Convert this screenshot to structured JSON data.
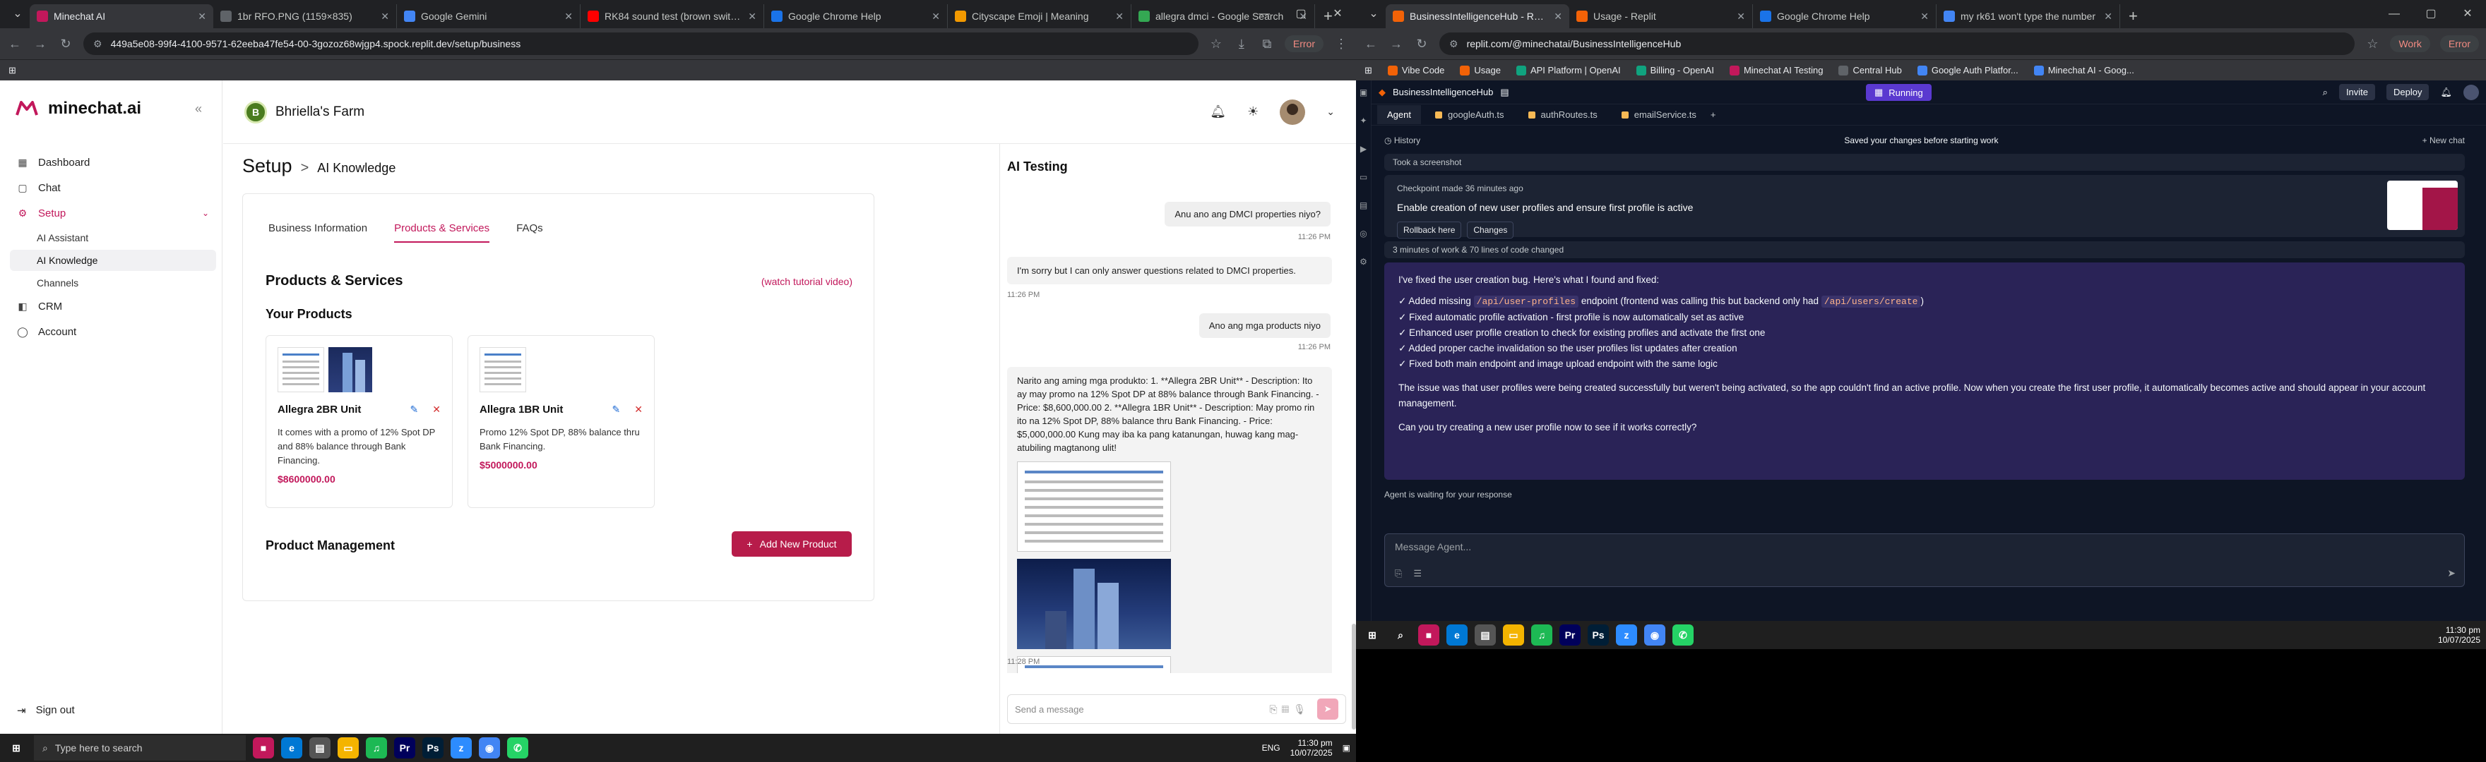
{
  "left_browser": {
    "tabs": [
      {
        "label": "Minechat AI",
        "color": "#c2185b",
        "active": true
      },
      {
        "label": "1br RFO.PNG (1159×835)",
        "color": "#5f6368"
      },
      {
        "label": "Google Gemini",
        "color": "#4285f4"
      },
      {
        "label": "RK84 sound test (brown switch)",
        "color": "#ff0000"
      },
      {
        "label": "Google Chrome Help",
        "color": "#1a73e8"
      },
      {
        "label": "Cityscape Emoji | Meaning",
        "color": "#f29900"
      },
      {
        "label": "allegra dmci - Google Search",
        "color": "#34a853"
      }
    ],
    "url": "449a5e08-99f4-4100-9571-62eeba47fe54-00-3gozoz68wjgp4.spock.replit.dev/setup/business",
    "error_label": "Error"
  },
  "sidebar": {
    "brand": "minechat.ai",
    "items": [
      {
        "label": "Dashboard",
        "icon": "grid-icon"
      },
      {
        "label": "Chat",
        "icon": "chat-icon"
      },
      {
        "label": "Setup",
        "icon": "gear-icon",
        "active": true
      }
    ],
    "sub_items": [
      "AI Assistant",
      "AI Knowledge",
      "Channels"
    ],
    "items2": [
      {
        "label": "CRM",
        "icon": "crm-icon"
      },
      {
        "label": "Account",
        "icon": "user-icon"
      }
    ],
    "signout": "Sign out"
  },
  "header": {
    "farm_name": "Bhriella's Farm"
  },
  "setup": {
    "title": "Setup",
    "crumb": "AI Knowledge",
    "tabs": [
      "Business Information",
      "Products & Services",
      "FAQs"
    ],
    "section_title": "Products & Services",
    "tutorial_link": "(watch tutorial video)",
    "your_products": "Your Products",
    "products": [
      {
        "name": "Allegra 2BR Unit",
        "desc": "It comes with a promo of 12% Spot DP and 88% balance through Bank Financing.",
        "price": "$8600000.00"
      },
      {
        "name": "Allegra 1BR Unit",
        "desc": "Promo 12% Spot DP, 88% balance thru Bank Financing.",
        "price": "$5000000.00"
      }
    ],
    "product_management": "Product Management",
    "add_button": "Add New Product"
  },
  "ai_testing": {
    "title": "AI Testing",
    "messages": [
      {
        "role": "user",
        "text": "Anu ano ang DMCI properties niyo?",
        "time": "11:26 PM"
      },
      {
        "role": "bot",
        "text": "I'm sorry but I can only answer questions related to DMCI properties.",
        "time": "11:26 PM"
      },
      {
        "role": "user",
        "text": "Ano ang mga products niyo",
        "time": "11:26 PM"
      },
      {
        "role": "bot",
        "text": "Narito ang aming mga produkto: 1. **Allegra 2BR Unit** - Description: Ito ay may promo na 12% Spot DP at 88% balance through Bank Financing. - Price: $8,600,000.00 2. **Allegra 1BR Unit** - Description: May promo rin ito na 12% Spot DP, 88% balance thru Bank Financing. - Price: $5,000,000.00 Kung may iba ka pang katanungan, huwag kang mag-atubiling magtanong ulit!",
        "time": "11:28 PM"
      }
    ],
    "composer_placeholder": "Send a message"
  },
  "right_browser": {
    "tabs": [
      {
        "label": "BusinessIntelligenceHub - Replit",
        "color": "#f26207",
        "active": true
      },
      {
        "label": "Usage - Replit",
        "color": "#f26207"
      },
      {
        "label": "Google Chrome Help",
        "color": "#1a73e8"
      },
      {
        "label": "my rk61 won't type the number",
        "color": "#4285f4"
      }
    ],
    "url": "replit.com/@minechatai/BusinessIntelligenceHub",
    "work_label": "Work",
    "error_label": "Error",
    "bookmarks": [
      "Vibe Code",
      "Usage",
      "API Platform | OpenAI",
      "Billing - OpenAI",
      "Minechat AI Testing",
      "Central Hub",
      "Google Auth Platfor...",
      "Minechat AI - Goog..."
    ]
  },
  "replit": {
    "project": "BusinessIntelligenceHub",
    "status": "Running",
    "invite": "Invite",
    "deploy": "Deploy",
    "tabs": [
      "Agent",
      "googleAuth.ts",
      "authRoutes.ts",
      "emailService.ts"
    ],
    "history": "History",
    "saved": "Saved your changes before starting work",
    "new_chat": "+ New chat",
    "took_screenshot": "Took a screenshot",
    "checkpoint_time": "Checkpoint made 36 minutes ago",
    "checkpoint_title": "Enable creation of new user profiles and ensure first profile is active",
    "rollback": "Rollback here",
    "changes": "Changes",
    "worklog": "3 minutes of work & 70 lines of code changed",
    "message": {
      "intro": "I've fixed the user creation bug. Here's what I found and fixed:",
      "b1_pre": "✓ Added missing",
      "b1_code1": "/api/user-profiles",
      "b1_mid": "endpoint (frontend was calling this but backend only had",
      "b1_code2": "/api/users/create",
      "b1_post": ")",
      "b2": "✓ Fixed automatic profile activation - first profile is now automatically set as active",
      "b3": "✓ Enhanced user profile creation to check for existing profiles and activate the first one",
      "b4": "✓ Added proper cache invalidation so the user profiles list updates after creation",
      "b5": "✓ Fixed both main endpoint and image upload endpoint with the same logic",
      "para": "The issue was that user profiles were being created successfully but weren't being activated, so the app couldn't find an active profile. Now when you create the first user profile, it automatically becomes active and should appear in your account management.",
      "question": "Can you try creating a new user profile now to see if it works correctly?"
    },
    "waiting": "Agent is waiting for your response",
    "input_placeholder": "Message Agent..."
  },
  "taskbar_left": {
    "search": "Type here to search",
    "time": "11:30 pm",
    "date": "10/07/2025",
    "lang": "ENG"
  },
  "taskbar_right": {
    "time": "11:30 pm",
    "date": "10/07/2025"
  }
}
